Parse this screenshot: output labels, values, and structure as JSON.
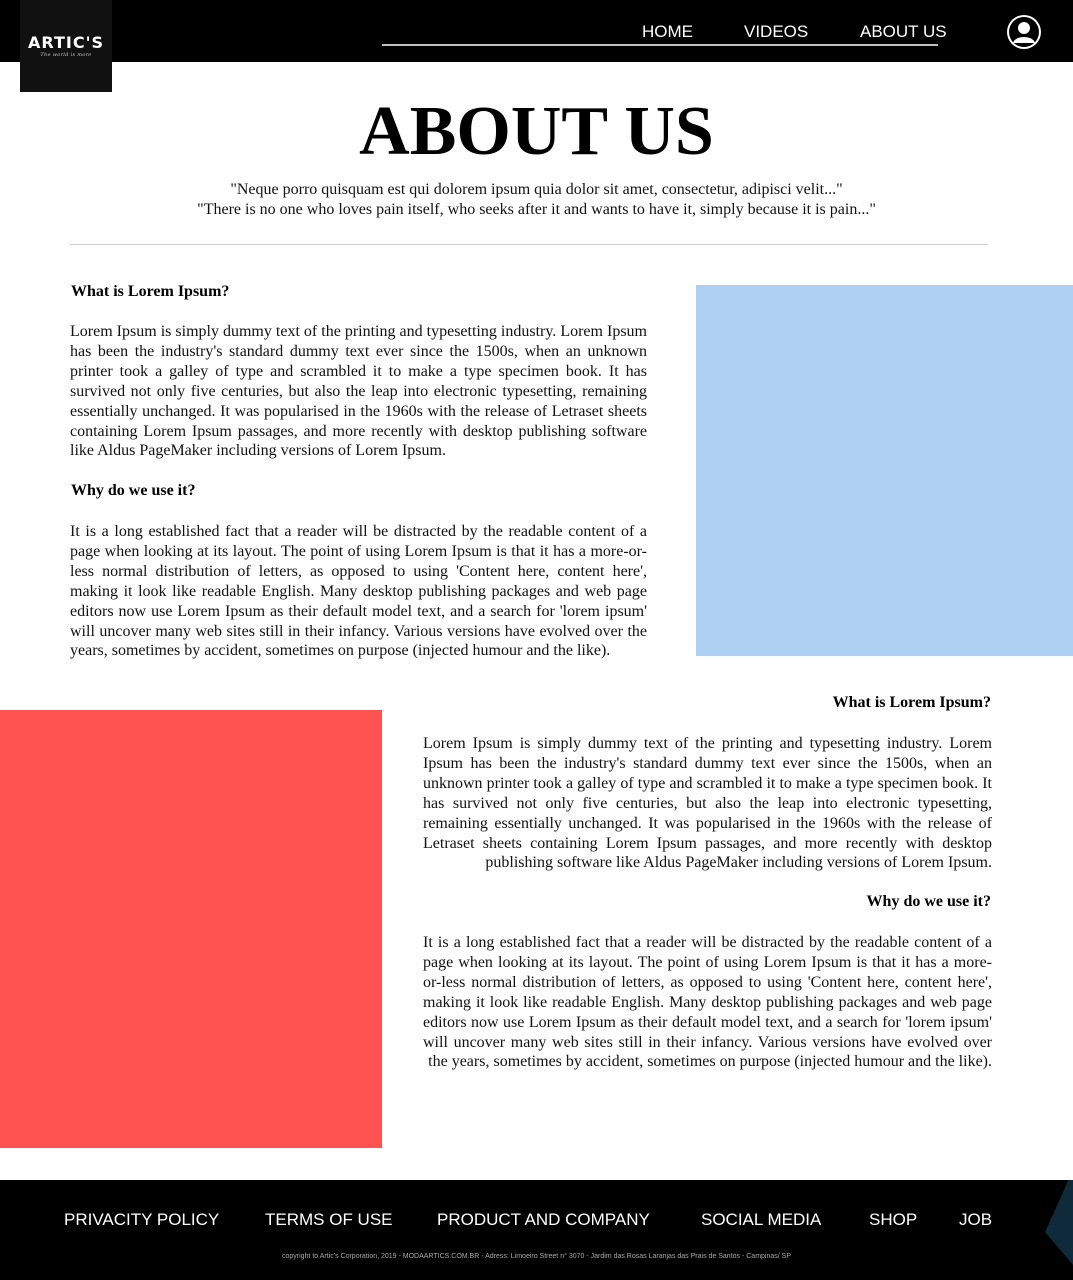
{
  "header": {
    "logo": {
      "name": "ARTIC'S",
      "tagline": "The world is more"
    },
    "nav": [
      {
        "label": "HOME"
      },
      {
        "label": "VIDEOS"
      },
      {
        "label": "ABOUT US"
      }
    ],
    "avatar_icon": "user-avatar-icon"
  },
  "hero": {
    "title": "ABOUT US",
    "quote_line1": "\"Neque porro quisquam est qui dolorem ipsum quia dolor sit amet, consectetur, adipisci velit...\"",
    "quote_line2": "\"There is no one who loves pain itself, who seeks after it and wants to have it, simply because it is pain...\""
  },
  "section1": {
    "heading1": "What is Lorem Ipsum?",
    "paragraph1": "Lorem Ipsum is simply dummy text of the printing and typesetting industry. Lorem Ipsum has been the industry's standard dummy text ever since the 1500s, when an unknown printer took a galley of type and scrambled it to make a type specimen book. It has survived not only five centuries, but also the leap into electronic typesetting, remaining essentially unchanged. It was popularised in the 1960s with the release of Letraset sheets containing Lorem Ipsum passages, and more recently with desktop publishing software like Aldus PageMaker including versions of Lorem Ipsum.",
    "heading2": "Why do we use it?",
    "paragraph2": "It is a long established fact that a reader will be distracted by the readable content of a page when looking at its layout. The point of using Lorem Ipsum is that it has a more-or-less normal distribution of letters, as opposed to using 'Content here, content here', making it look like readable English. Many desktop publishing packages and web page editors now use Lorem Ipsum as their default model text, and a search for 'lorem ipsum' will uncover many web sites still in their infancy. Various versions have evolved over the years, sometimes by accident, sometimes on purpose (injected humour and the like)."
  },
  "section2": {
    "heading1": "What is Lorem Ipsum?",
    "paragraph1": "Lorem Ipsum is simply dummy text of the printing and typesetting industry. Lorem Ipsum has been the industry's standard dummy text ever since the 1500s, when an unknown printer took a galley of type and scrambled it to make a type specimen book. It has survived not only five centuries, but also the leap into electronic typesetting, remaining essentially unchanged. It was popularised in the 1960s with the release of Letraset sheets containing Lorem Ipsum passages, and more recently with desktop publishing software like Aldus PageMaker including versions of Lorem Ipsum.",
    "heading2": "Why do we use it?",
    "paragraph2": "It is a long established fact that a reader will be distracted by the readable content of a page when looking at its layout. The point of using Lorem Ipsum is that it has a more-or-less normal distribution of letters, as opposed to using 'Content here, content here', making it look like readable English. Many desktop publishing packages and web page editors now use Lorem Ipsum as their default model text, and a search for 'lorem ipsum' will uncover many web sites still in their infancy. Various versions have evolved over the years, sometimes by accident, sometimes on purpose (injected humour and the like)."
  },
  "colors": {
    "blue_block": "#aed1f3",
    "red_block": "#fc5250",
    "bar": "#000000",
    "corner": "#0e2a3b"
  },
  "footer": {
    "links": [
      {
        "label": "PRIVACITY POLICY"
      },
      {
        "label": "TERMS OF USE"
      },
      {
        "label": "PRODUCT AND COMPANY"
      },
      {
        "label": "SOCIAL MEDIA"
      },
      {
        "label": "SHOP"
      },
      {
        "label": "JOB"
      }
    ],
    "copyright": "copyright to Artic's Corporation, 2019 - MODAARTICS.COM.BR - Adress: Limoeiro Street n° 3070 - Jardim das Rosas Laranjas das Prais de Santos - Campinas/ SP"
  }
}
